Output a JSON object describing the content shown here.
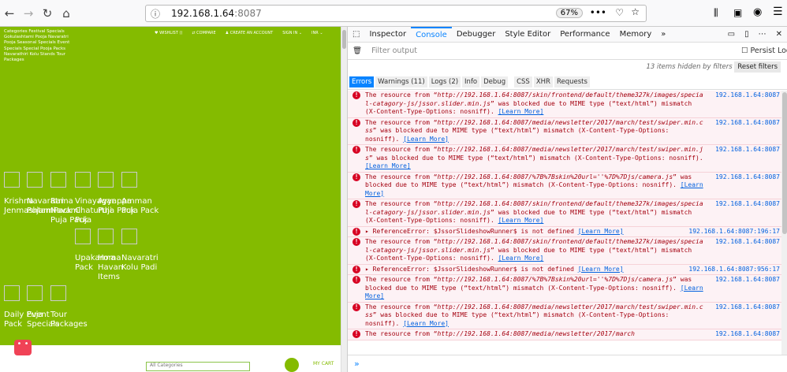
{
  "browser": {
    "host": "192.168.1.64",
    "port": ":8087",
    "zoom": "67%"
  },
  "page": {
    "categories": "Categories Festival Specials Gokulashtami Pooja Navaratri Pooja Seasonal Specials Event Specials Special Pooja Packs Navarathiri Kolu Stands Tour Packages",
    "top_links": [
      "♥ WISHLIST ()",
      "⇄ COMPARE",
      "♟ CREATE AN ACCOUNT",
      "SIGN IN ⌄",
      "INR ⌄"
    ],
    "tiles": [
      "Krishna Jenmashtami",
      "Navaratri Pujam Pack",
      "Rama Navami Puja Pack",
      "Vinayagar Chaturthi Puja",
      "Ayyappa Puja Pack",
      "Amman Puja Pack",
      "Upakarma Pack",
      "Homa Havan Items",
      "Navaratri Kolu Padi",
      "Daily Puja Pack",
      "Event Specials",
      "Tour Packages"
    ],
    "search_placeholder": "All Categories",
    "cart": "MY CART"
  },
  "devtools": {
    "tabs": [
      "Inspector",
      "Console",
      "Debugger",
      "Style Editor",
      "Performance",
      "Memory"
    ],
    "filter_placeholder": "Filter output",
    "persist": "Persist Logs",
    "hidden": "13 items hidden by filters",
    "reset": "Reset filters",
    "filters": [
      "Errors",
      "Warnings (11)",
      "Logs (2)",
      "Info",
      "Debug",
      "CSS",
      "XHR",
      "Requests"
    ],
    "learn_more": "[Learn More]",
    "messages": [
      {
        "pre": "The resource from “",
        "url": "http://192.168.1.64:8087/skin/frontend/default/theme327k/images/special-catagory-js/jssor.slider.min.js",
        "post": "” was blocked due to MIME type (“text/html”) mismatch (X-Content-Type-Options: nosniff). ",
        "src": "192.168.1.64:8087"
      },
      {
        "pre": "The resource from “",
        "url": "http://192.168.1.64:8087/media/newsletter/2017/march/test/swiper.min.css",
        "post": "” was blocked due to MIME type (“text/html”) mismatch (X-Content-Type-Options: nosniff). ",
        "src": "192.168.1.64:8087"
      },
      {
        "pre": "The resource from “",
        "url": "http://192.168.1.64:8087/media/newsletter/2017/march/test/swiper.min.js",
        "post": "” was blocked due to MIME type (“text/html”) mismatch (X-Content-Type-Options: nosniff). ",
        "src": "192.168.1.64:8087"
      },
      {
        "pre": "The resource from “",
        "url": "http://192.168.1.64:8087/%7B%7Bskin%20url=''%7D%7Djs/camera.js",
        "post": "” was blocked due to MIME type (“text/html”) mismatch (X-Content-Type-Options: nosniff). ",
        "src": "192.168.1.64:8087"
      },
      {
        "pre": "The resource from “",
        "url": "http://192.168.1.64:8087/skin/frontend/default/theme327k/images/special-catagory-js/jssor.slider.min.js",
        "post": "” was blocked due to MIME type (“text/html”) mismatch (X-Content-Type-Options: nosniff). ",
        "src": "192.168.1.64:8087"
      },
      {
        "pre": "▸ ReferenceError: $JssorSlideshowRunner$ is not defined ",
        "url": "",
        "post": "",
        "src": "192.168.1.64:8087:196:17"
      },
      {
        "pre": "The resource from “",
        "url": "http://192.168.1.64:8087/skin/frontend/default/theme327k/images/special-catagory-js/jssor.slider.min.js",
        "post": "” was blocked due to MIME type (“text/html”) mismatch (X-Content-Type-Options: nosniff). ",
        "src": "192.168.1.64:8087"
      },
      {
        "pre": "▸ ReferenceError: $JssorSlideshowRunner$ is not defined ",
        "url": "",
        "post": "",
        "src": "192.168.1.64:8087:956:17"
      },
      {
        "pre": "The resource from “",
        "url": "http://192.168.1.64:8087/%7B%7Bskin%20url=''%7D%7Djs/camera.js",
        "post": "” was blocked due to MIME type (“text/html”) mismatch (X-Content-Type-Options: nosniff). ",
        "src": "192.168.1.64:8087"
      },
      {
        "pre": "The resource from “",
        "url": "http://192.168.1.64:8087/media/newsletter/2017/march/test/swiper.min.css",
        "post": "” was blocked due to MIME type (“text/html”) mismatch (X-Content-Type-Options: nosniff). ",
        "src": "192.168.1.64:8087"
      },
      {
        "pre": "The resource from “",
        "url": "http://192.168.1.64:8087/media/newsletter/2017/march",
        "post": "",
        "src": "192.168.1.64:8087"
      }
    ],
    "prompt": "»"
  }
}
